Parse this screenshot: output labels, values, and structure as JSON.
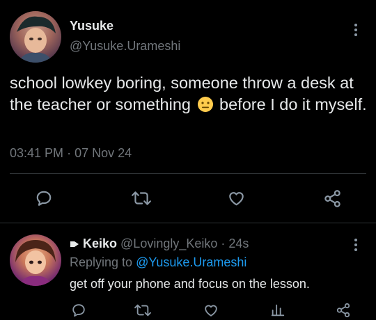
{
  "tweet": {
    "author_name": "Yusuke",
    "author_handle": "@Yusuke.Urameshi",
    "text_before_emoji": "school lowkey boring, someone throw a desk at the teacher or something",
    "text_after_emoji": "before I do it myself.",
    "timestamp": "03:41 PM",
    "separator": "·",
    "date": "07 Nov 24",
    "emoji_icon": "neutral-face-emoji"
  },
  "actions": [
    "reply-icon",
    "retweet-icon",
    "like-icon",
    "share-icon"
  ],
  "reply": {
    "author_name": "Keiko",
    "author_handle": "@Lovingly_Keiko",
    "time_ago": "24s",
    "separator": "·",
    "replying_label": "Replying to",
    "replying_to": "@Yusuke.Urameshi",
    "text": "get off your phone and focus on the lesson."
  },
  "colors": {
    "background": "#000000",
    "text": "#e7e9ea",
    "muted": "#71767b",
    "link": "#1d9bf0",
    "divider": "#2f3336"
  }
}
